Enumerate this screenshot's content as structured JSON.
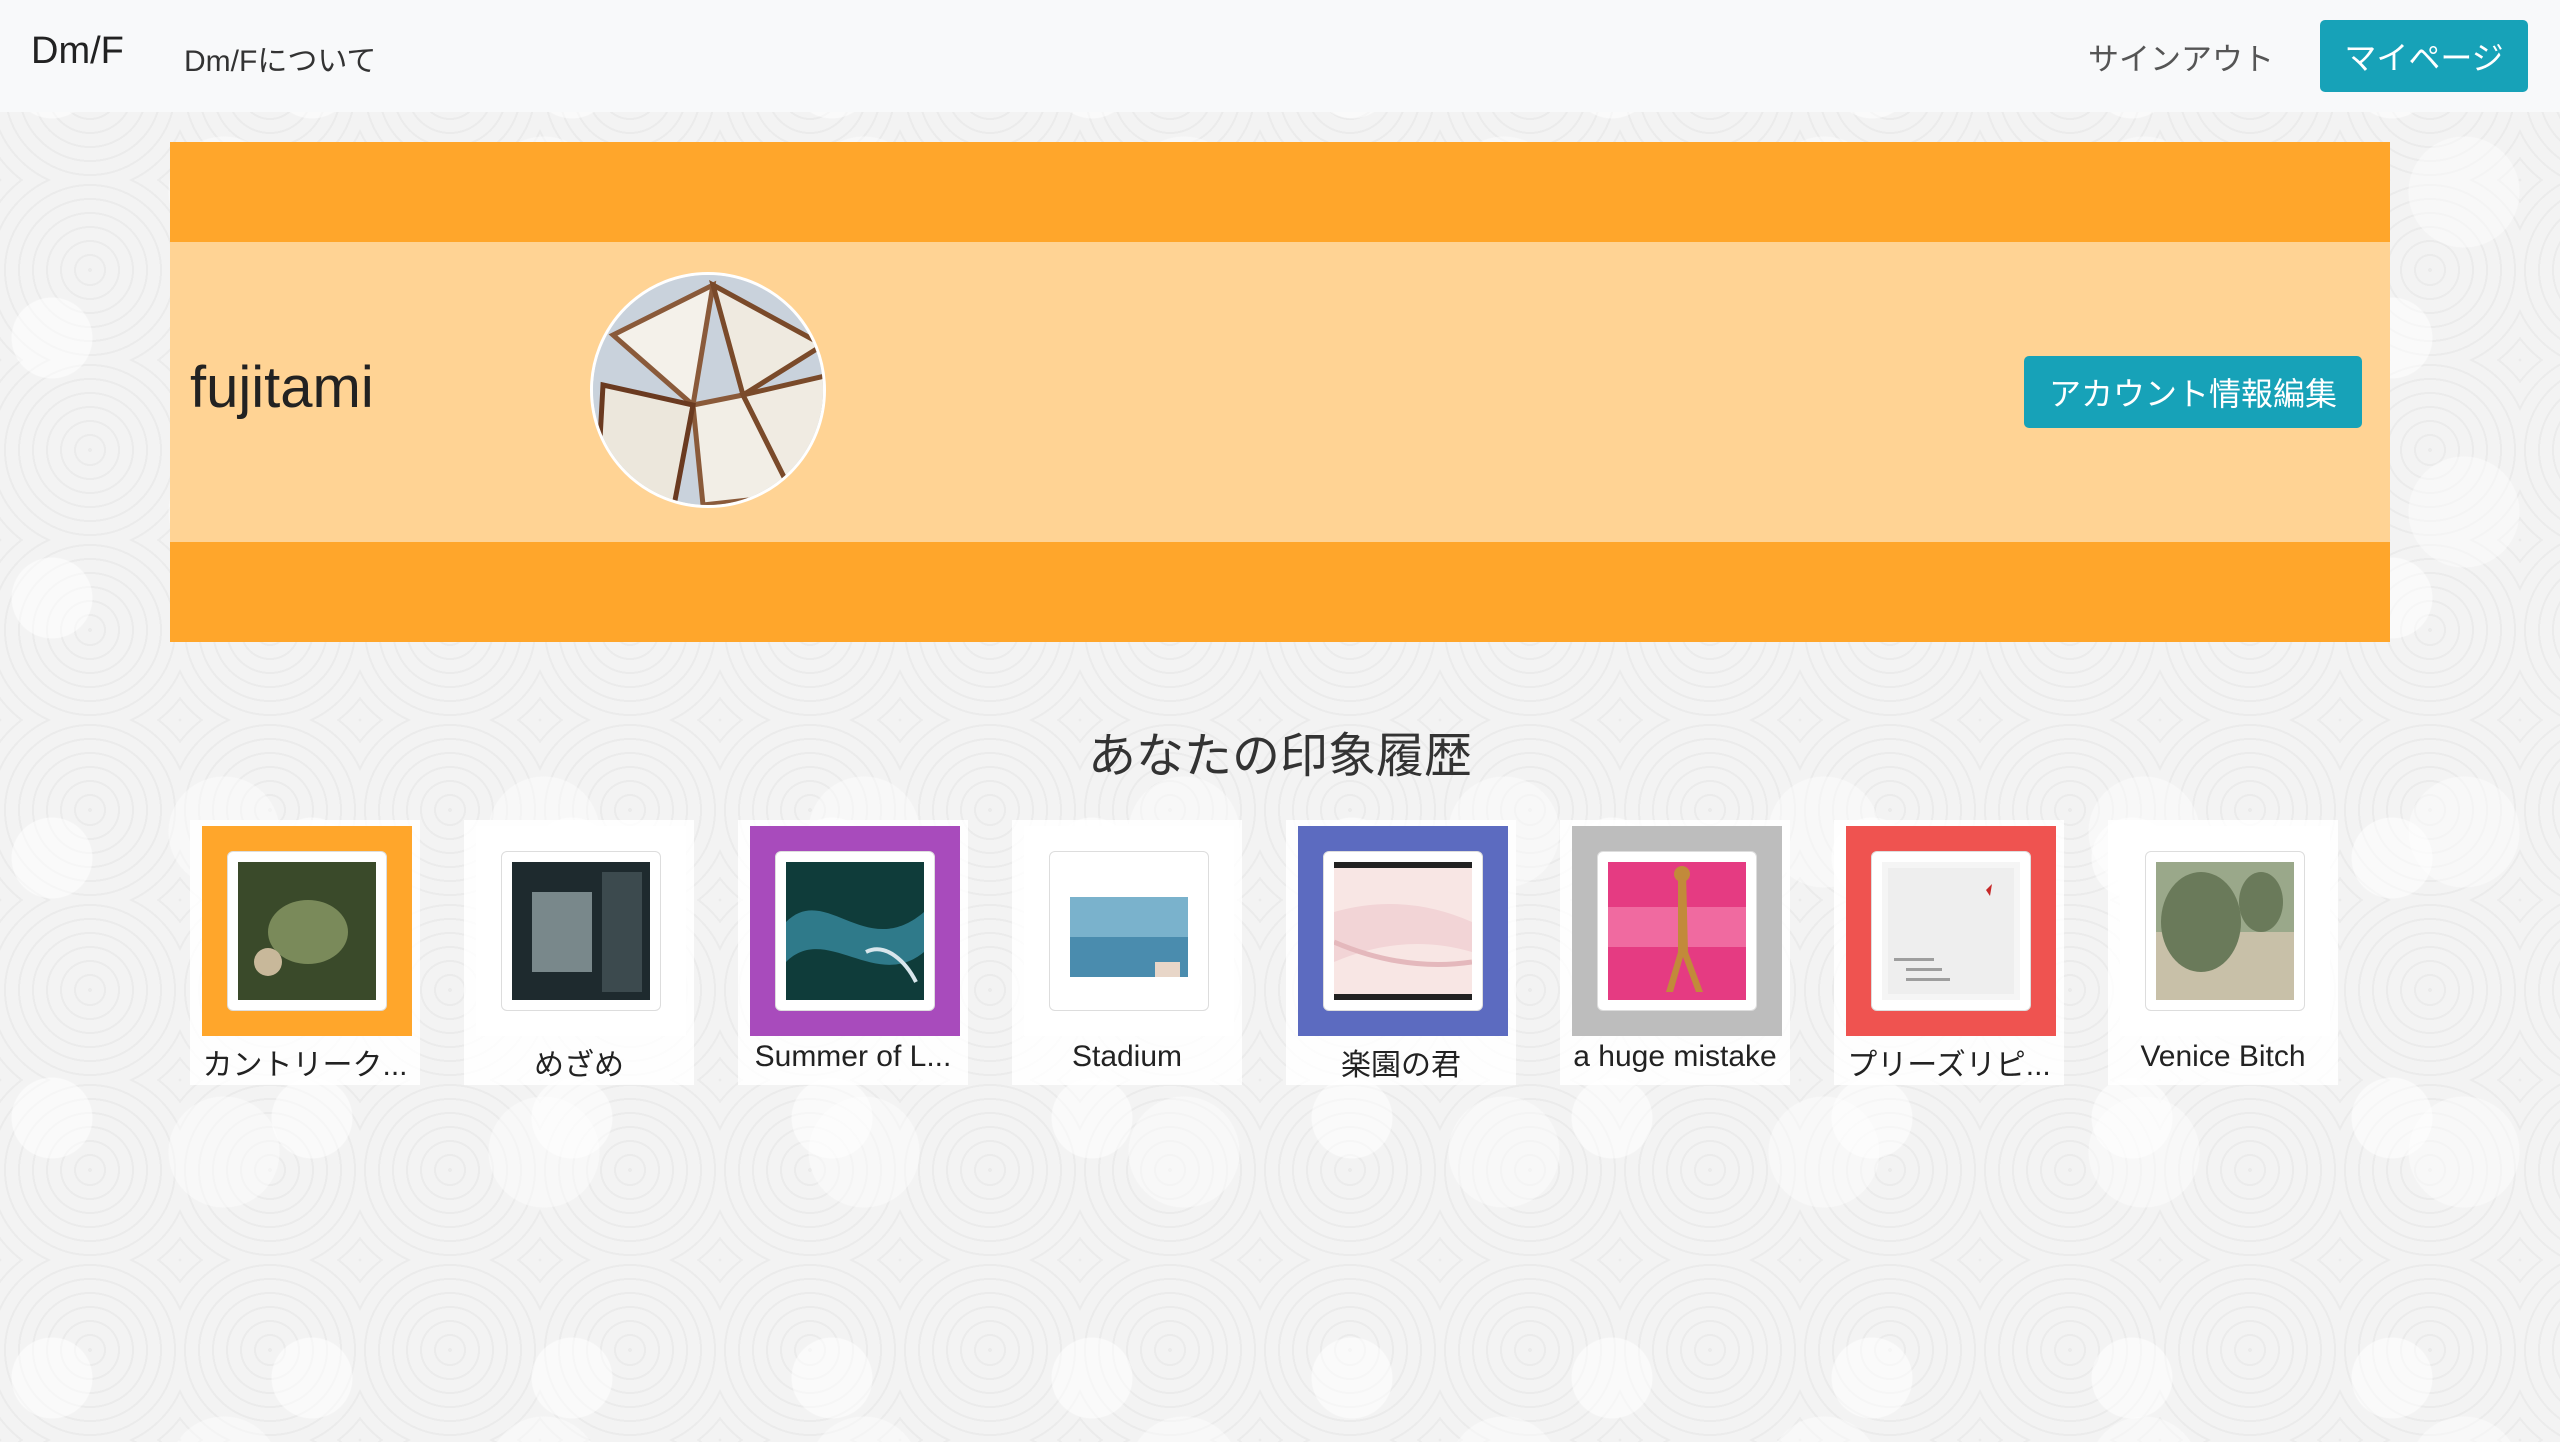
{
  "nav": {
    "brand": "Dm/F",
    "about": "Dm/Fについて",
    "signout": "サインアウト",
    "mypage": "マイページ"
  },
  "profile": {
    "username": "fujitami",
    "edit_button": "アカウント情報編集",
    "avatar_icon": "bread-photo-avatar"
  },
  "history": {
    "title": "あなたの印象履歴",
    "items": [
      {
        "title": "カントリーク...",
        "frame_color": "#ffa62b",
        "art_colors": [
          "#3a4a2a",
          "#7a8a5a",
          "#c8b89a"
        ]
      },
      {
        "title": "めざめ",
        "frame_color": "#ffffff",
        "art_colors": [
          "#1e2a2e",
          "#9fb0b4",
          "#3c4a4e"
        ]
      },
      {
        "title": "Summer of L...",
        "frame_color": "#a84bbc",
        "art_colors": [
          "#0f3c3a",
          "#2f7a8a",
          "#d8e6ec"
        ]
      },
      {
        "title": "Stadium",
        "frame_color": "#ffffff",
        "art_colors": [
          "#4a8cae",
          "#7ab2cc",
          "#e8d6c8"
        ]
      },
      {
        "title": "楽園の君",
        "frame_color": "#5c6bc0",
        "art_colors": [
          "#f2d4d6",
          "#f8e6e4",
          "#e4b8bc"
        ]
      },
      {
        "title": "a huge mistake",
        "frame_color": "#bdbdbd",
        "art_colors": [
          "#e53b82",
          "#f06aa0",
          "#c28a3a"
        ]
      },
      {
        "title": "プリーズリピ...",
        "frame_color": "#ef5350",
        "art_colors": [
          "#eeeeee",
          "#f5f5f5",
          "#c62828"
        ]
      },
      {
        "title": "Venice Bitch",
        "frame_color": "#ffffff",
        "art_colors": [
          "#6a7a5a",
          "#9aa88a",
          "#c8c0a8"
        ]
      }
    ]
  }
}
